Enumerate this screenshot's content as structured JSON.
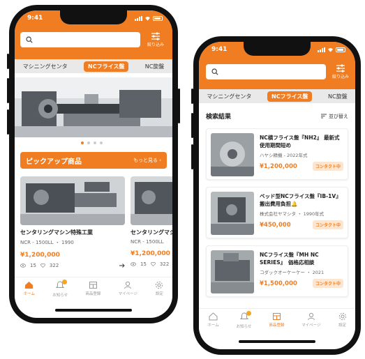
{
  "colors": {
    "accent": "#f07d22",
    "badge_bg": "#fde6d1",
    "tab_bar": "#e9e9e9"
  },
  "status": {
    "time": "9:41"
  },
  "search": {
    "placeholder": "",
    "filter_label": "絞り込み"
  },
  "tabs": [
    "マシニングセンタ",
    "NCフライス盤",
    "NC旋盤"
  ],
  "active_tab": "NCフライス盤",
  "nav": [
    {
      "label": "ホーム",
      "icon": "home-icon"
    },
    {
      "label": "お知らせ",
      "icon": "bell-icon"
    },
    {
      "label": "商品登録",
      "icon": "store-icon"
    },
    {
      "label": "マイページ",
      "icon": "user-icon"
    },
    {
      "label": "設定",
      "icon": "gear-icon"
    }
  ],
  "home": {
    "banner": {
      "slides": 4,
      "active": 0
    },
    "pickup": {
      "title": "ピックアップ商品",
      "more": "もっと見る ›"
    },
    "cards": [
      {
        "title": "センタリングマシン特殊工業",
        "sub": "NCR - 1500LL ・ 1990",
        "price": "¥1,200,000",
        "views": "15",
        "likes": "322"
      },
      {
        "title": "センタリングマシン",
        "sub": "NCR - 1500LL",
        "price": "¥1,200,000",
        "views": "15",
        "likes": "322"
      }
    ]
  },
  "search_results": {
    "title": "検索結果",
    "sort_label": "並び替え",
    "items": [
      {
        "title": "NC横フライス盤『NH2』 最新式　使用期間短め",
        "sub": "ハヤシ精機 - 2022年式",
        "price": "¥1,200,000",
        "status": "コンタクト中"
      },
      {
        "title": "ベッド型NCフライス盤『IB-1V』 搬出費用負担🔔",
        "sub": "株式会社ヤマシタ ・ 1990年式",
        "price": "¥450,000",
        "status": "コンタクト中"
      },
      {
        "title": "NCフライス盤『MH NC SERIES』　価格応相談",
        "sub": "コダックオーケーケー ・ 2021",
        "price": "¥1,500,000",
        "status": "コンタクト中"
      }
    ]
  }
}
